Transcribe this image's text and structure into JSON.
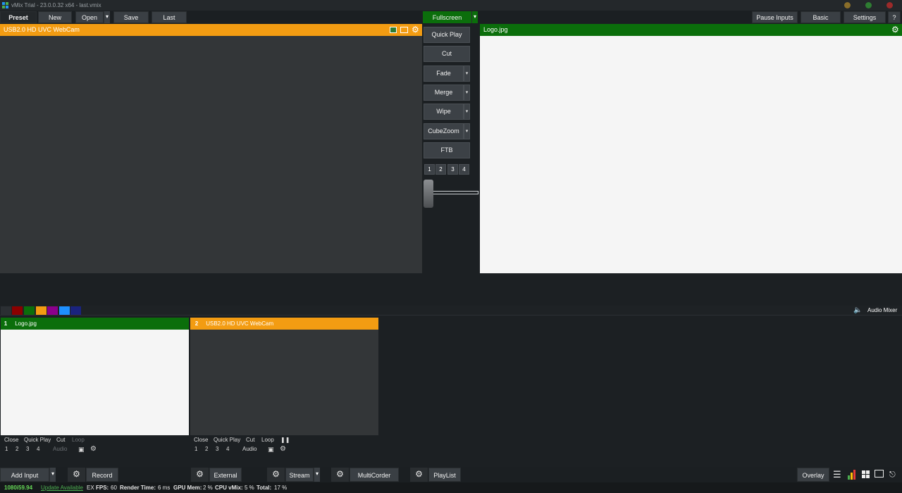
{
  "window": {
    "title": "vMix Trial - 23.0.0.32 x64 - last.vmix",
    "dots": [
      "#8a6e2a",
      "#2e7d32",
      "#9b2a2a"
    ]
  },
  "topbar": {
    "preset": "Preset",
    "new": "New",
    "open": "Open",
    "save": "Save",
    "last": "Last",
    "fullscreen": "Fullscreen",
    "pause_inputs": "Pause Inputs",
    "basic": "Basic",
    "settings": "Settings",
    "help": "?"
  },
  "preview": {
    "title": "USB2.0 HD UVC WebCam",
    "accent": "#f39c12"
  },
  "output": {
    "title": "Logo.jpg",
    "accent": "#0b6e0b"
  },
  "transitions": {
    "quick_play": "Quick Play",
    "cut": "Cut",
    "fade": "Fade",
    "merge": "Merge",
    "wipe": "Wipe",
    "cubezoom": "CubeZoom",
    "ftb": "FTB",
    "numbers": [
      "1",
      "2",
      "3",
      "4"
    ],
    "tbar_position": 0
  },
  "color_tags": [
    "#2b2f33",
    "#8b0000",
    "#0b6e0b",
    "#f39c12",
    "#8b008b",
    "#1e90ff",
    "#1a237e"
  ],
  "audio_mixer": {
    "label": "Audio Mixer"
  },
  "inputs": [
    {
      "number": "1",
      "name": "Logo.jpg",
      "controls": {
        "close": "Close",
        "quick_play": "Quick Play",
        "cut": "Cut",
        "loop": "Loop",
        "audio": "Audio"
      },
      "numbers": [
        "1",
        "2",
        "3",
        "4"
      ]
    },
    {
      "number": "2",
      "name": "USB2.0 HD UVC WebCam",
      "controls": {
        "close": "Close",
        "quick_play": "Quick Play",
        "cut": "Cut",
        "loop": "Loop",
        "audio": "Audio"
      },
      "numbers": [
        "1",
        "2",
        "3",
        "4"
      ]
    }
  ],
  "bottombar": {
    "add_input": "Add Input",
    "record": "Record",
    "external": "External",
    "stream": "Stream",
    "multicorder": "MultiCorder",
    "playlist": "PlayList",
    "overlay": "Overlay"
  },
  "status": {
    "resolution": "1080i59.94",
    "update": "Update Available",
    "ex": "EX",
    "fps_label": "FPS:",
    "fps": "60",
    "render_label": "Render Time:",
    "render": "6 ms",
    "gpu_label": "GPU Mem:",
    "gpu": "2 %",
    "cpu_label": "CPU vMix:",
    "cpu": "5 %",
    "total_label": "Total:",
    "total": "17 %"
  }
}
